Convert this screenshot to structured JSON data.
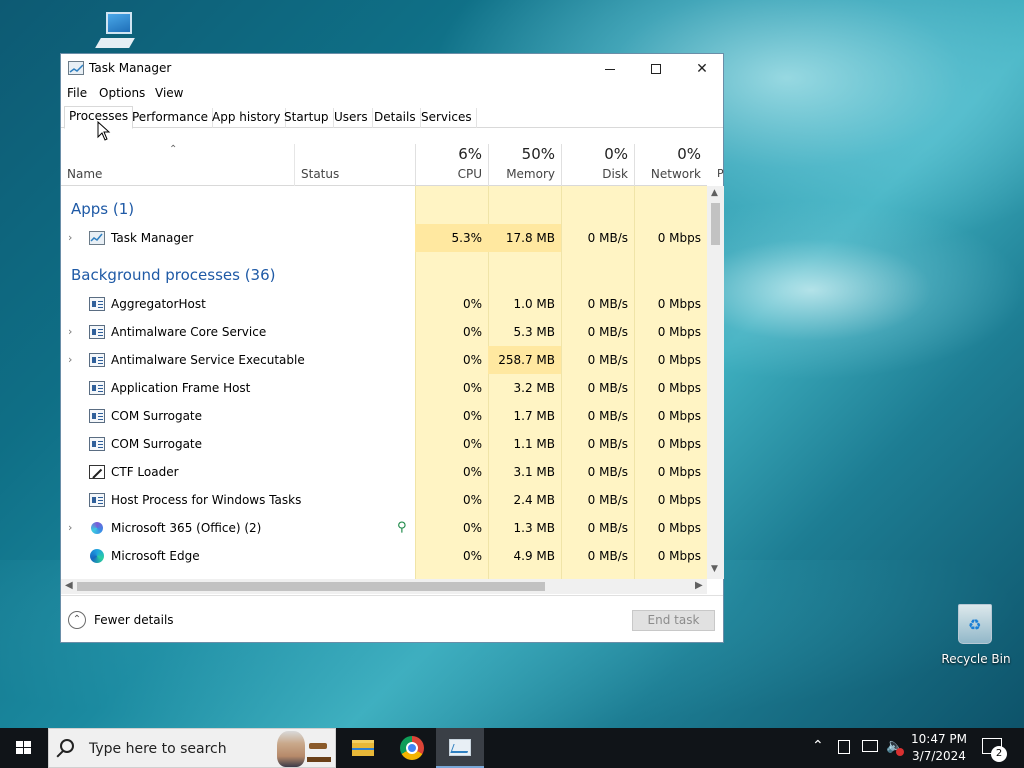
{
  "desktop": {
    "recycle_bin_label": "Recycle Bin"
  },
  "window": {
    "title": "Task Manager",
    "controls": {
      "minimize": "minimize",
      "maximize": "maximize",
      "close": "✕"
    },
    "menu": [
      "File",
      "Options",
      "View"
    ],
    "tabs": [
      "Processes",
      "Performance",
      "App history",
      "Startup",
      "Users",
      "Details",
      "Services"
    ],
    "active_tab": "Processes"
  },
  "columns": {
    "name": "Name",
    "status": "Status",
    "cpu": {
      "pct": "6%",
      "label": "CPU"
    },
    "memory": {
      "pct": "50%",
      "label": "Memory"
    },
    "disk": {
      "pct": "0%",
      "label": "Disk"
    },
    "network": {
      "pct": "0%",
      "label": "Network"
    },
    "truncated": "P"
  },
  "groups": {
    "apps": "Apps (1)",
    "background": "Background processes (36)"
  },
  "apps": [
    {
      "name": "Task Manager",
      "cpu": "5.3%",
      "memory": "17.8 MB",
      "disk": "0 MB/s",
      "network": "0 Mbps",
      "expandable": true
    }
  ],
  "background": [
    {
      "name": "AggregatorHost",
      "cpu": "0%",
      "memory": "1.0 MB",
      "disk": "0 MB/s",
      "network": "0 Mbps",
      "expandable": false,
      "icon": "system-process-icon"
    },
    {
      "name": "Antimalware Core Service",
      "cpu": "0%",
      "memory": "5.3 MB",
      "disk": "0 MB/s",
      "network": "0 Mbps",
      "expandable": true,
      "icon": "system-process-icon"
    },
    {
      "name": "Antimalware Service Executable",
      "cpu": "0%",
      "memory": "258.7 MB",
      "disk": "0 MB/s",
      "network": "0 Mbps",
      "expandable": true,
      "icon": "system-process-icon"
    },
    {
      "name": "Application Frame Host",
      "cpu": "0%",
      "memory": "3.2 MB",
      "disk": "0 MB/s",
      "network": "0 Mbps",
      "expandable": false,
      "icon": "system-process-icon"
    },
    {
      "name": "COM Surrogate",
      "cpu": "0%",
      "memory": "1.7 MB",
      "disk": "0 MB/s",
      "network": "0 Mbps",
      "expandable": false,
      "icon": "system-process-icon"
    },
    {
      "name": "COM Surrogate",
      "cpu": "0%",
      "memory": "1.1 MB",
      "disk": "0 MB/s",
      "network": "0 Mbps",
      "expandable": false,
      "icon": "system-process-icon"
    },
    {
      "name": "CTF Loader",
      "cpu": "0%",
      "memory": "3.1 MB",
      "disk": "0 MB/s",
      "network": "0 Mbps",
      "expandable": false,
      "icon": "ctf-loader-icon"
    },
    {
      "name": "Host Process for Windows Tasks",
      "cpu": "0%",
      "memory": "2.4 MB",
      "disk": "0 MB/s",
      "network": "0 Mbps",
      "expandable": false,
      "icon": "system-process-icon"
    },
    {
      "name": "Microsoft 365 (Office) (2)",
      "cpu": "0%",
      "memory": "1.3 MB",
      "disk": "0 MB/s",
      "network": "0 Mbps",
      "expandable": true,
      "icon": "office-icon"
    },
    {
      "name": "Microsoft Edge",
      "cpu": "0%",
      "memory": "4.9 MB",
      "disk": "0 MB/s",
      "network": "0 Mbps",
      "expandable": false,
      "icon": "edge-icon"
    }
  ],
  "footer": {
    "fewer_details": "Fewer details",
    "end_task": "End task"
  },
  "taskbar": {
    "search_placeholder": "Type here to search",
    "time": "10:47 PM",
    "date": "3/7/2024",
    "notification_count": "2"
  }
}
